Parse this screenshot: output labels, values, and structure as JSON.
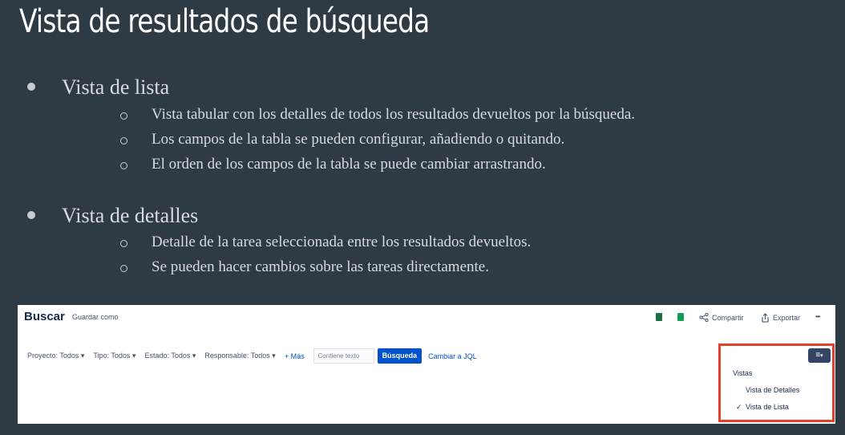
{
  "slide": {
    "title": "Vista de resultados de búsqueda",
    "sections": [
      {
        "heading": "Vista de lista",
        "items": [
          "Vista tabular con los detalles de todos los resultados devueltos por la búsqueda.",
          "Los campos de la tabla se pueden configurar, añadiendo o quitando.",
          "El orden de los campos de la tabla se puede cambiar arrastrando."
        ]
      },
      {
        "heading": "Vista de detalles",
        "items": [
          "Detalle de la tarea seleccionada entre los resultados devueltos.",
          "Se pueden hacer cambios sobre las tareas directamente."
        ]
      }
    ]
  },
  "screenshot": {
    "page_title": "Buscar",
    "save_as": "Guardar como",
    "toolbar": {
      "share": "Compartir",
      "export": "Exportar",
      "more": "•••"
    },
    "filters": [
      "Proyecto: Todos",
      "Tipo: Todos",
      "Estado: Todos",
      "Responsable: Todos"
    ],
    "more_filters": "+ Más",
    "text_placeholder": "Contiene texto",
    "search_button": "Búsqueda",
    "switch_jql": "Cambiar a JQL",
    "views_menu": {
      "header": "Vistas",
      "options": [
        "Vista de Detalles",
        "Vista de Lista"
      ],
      "selected": "Vista de Lista"
    },
    "colors": {
      "excel": "#1d6f42",
      "sheets": "#0f9d58",
      "primary": "#0052cc",
      "highlight": "#e4412d"
    }
  }
}
